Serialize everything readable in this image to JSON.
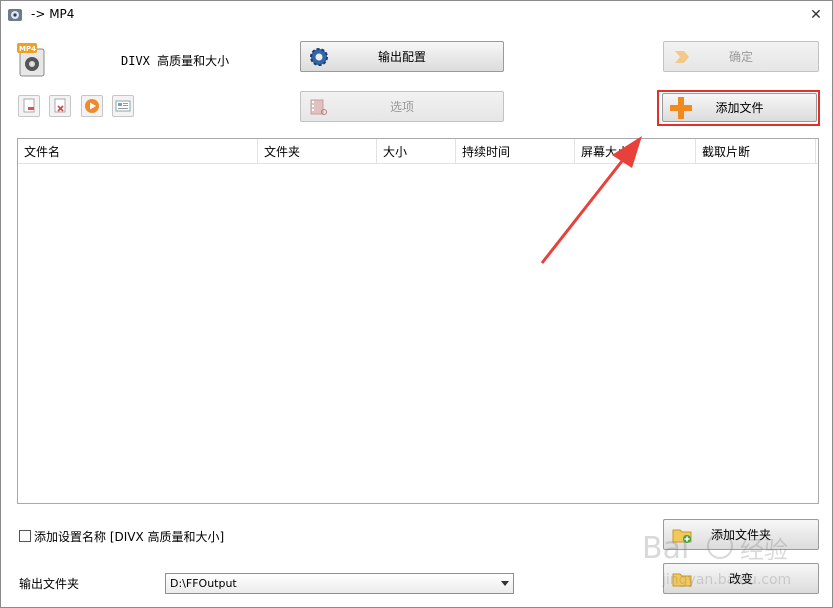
{
  "window": {
    "title": "-> MP4",
    "close_icon": "close-icon"
  },
  "profile": {
    "name": "DIVX 高质量和大小"
  },
  "buttons": {
    "output_config": "输出配置",
    "options": "选项",
    "ok": "确定",
    "add_file": "添加文件",
    "add_folder": "添加文件夹",
    "change": "改变"
  },
  "columns": [
    "文件名",
    "文件夹",
    "大小",
    "持续时间",
    "屏幕大小",
    "截取片断"
  ],
  "add_setting_name": "添加设置名称 [DIVX 高质量和大小]",
  "output_folder": {
    "label": "输出文件夹",
    "value": "D:\\FFOutput"
  },
  "colors": {
    "highlight": "#e0302a",
    "arrow": "#e8403a"
  }
}
